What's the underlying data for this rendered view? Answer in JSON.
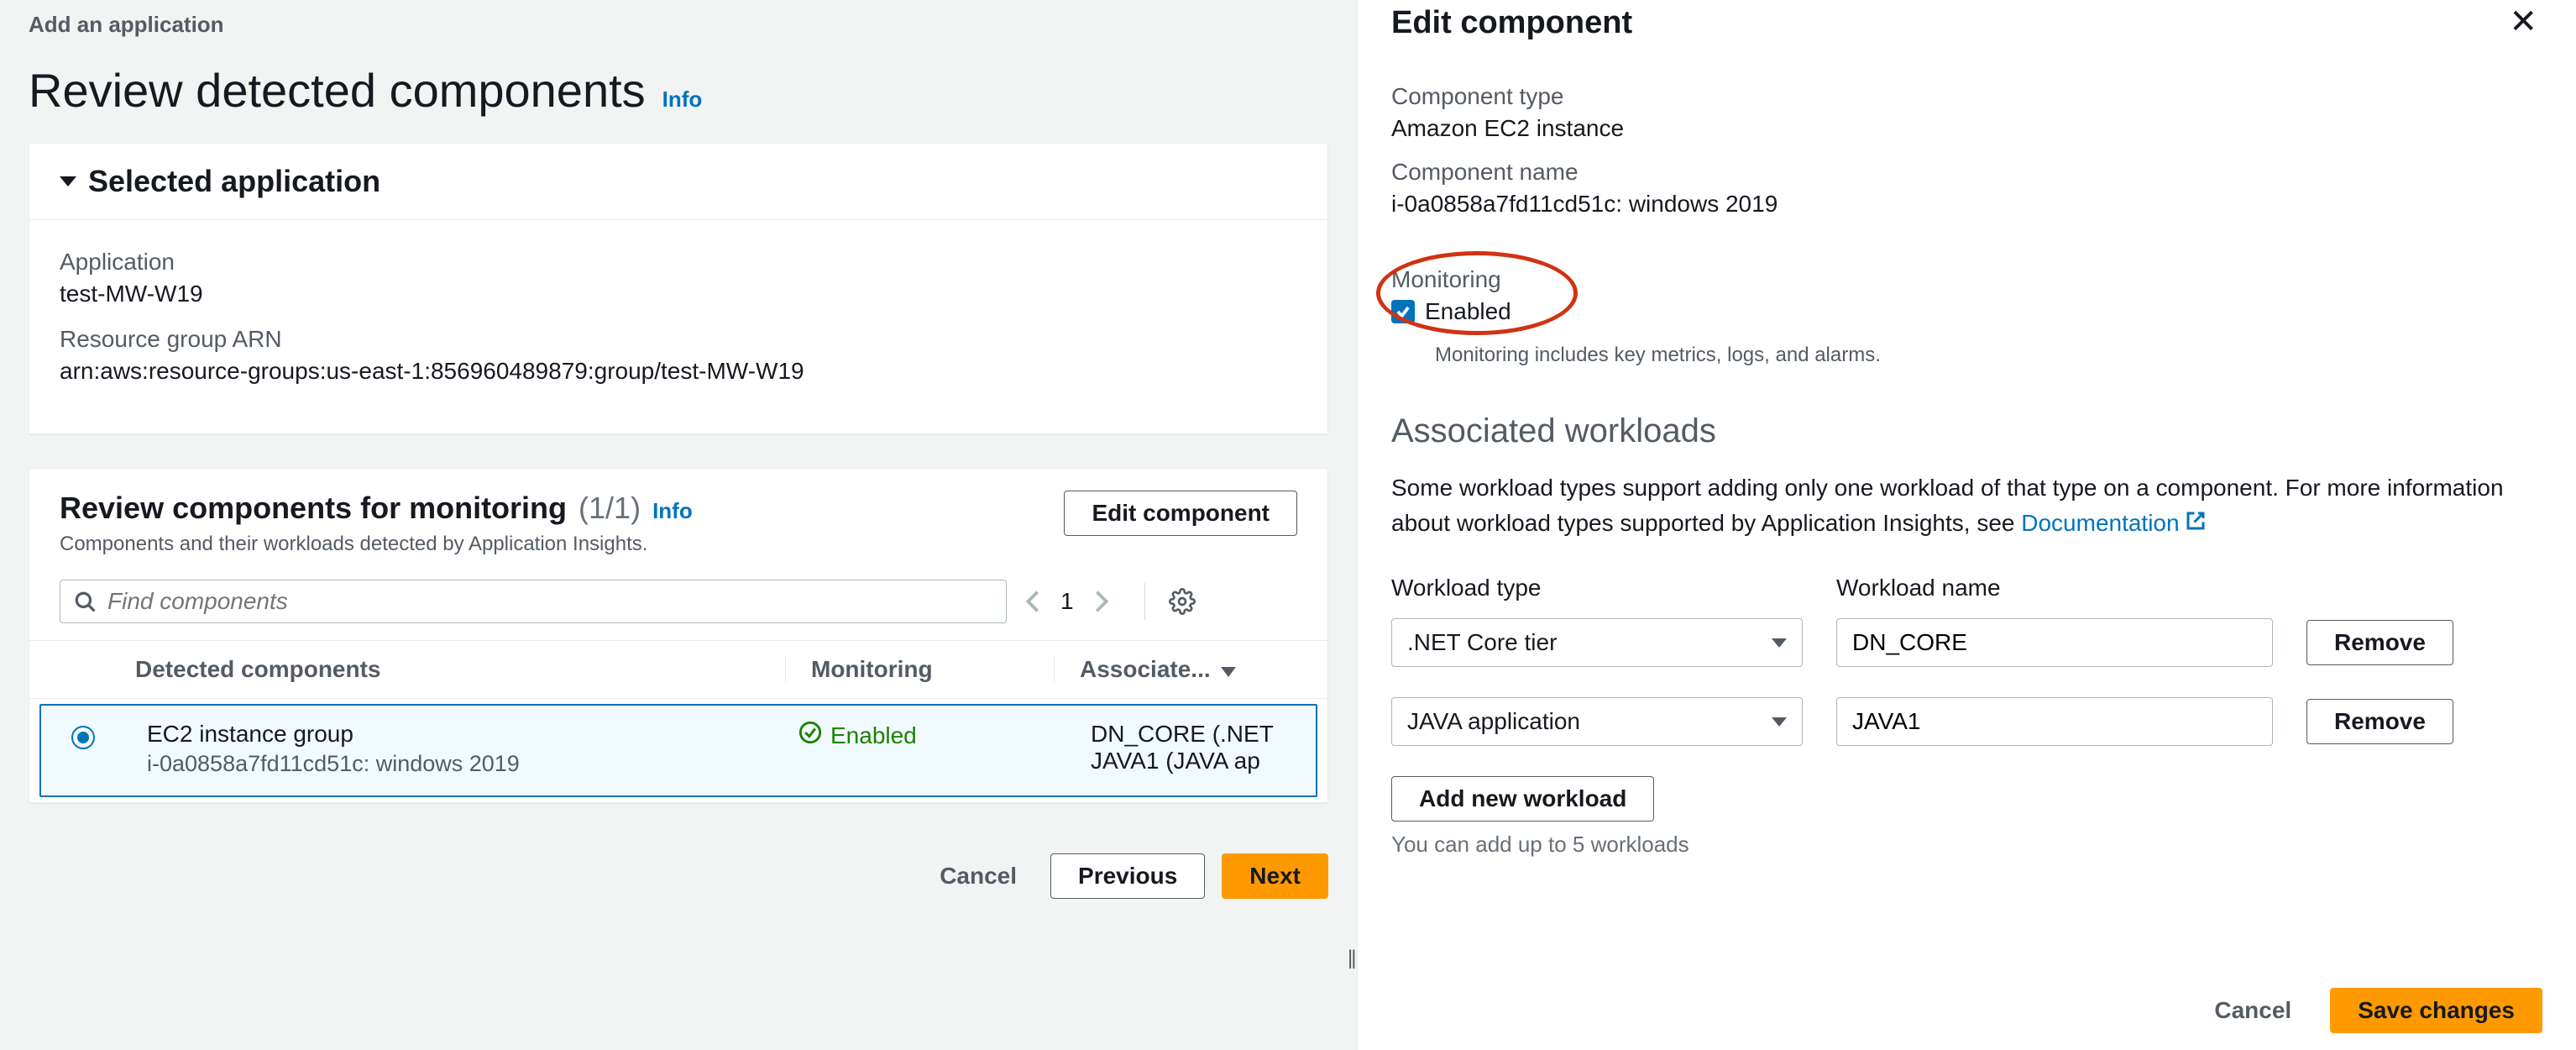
{
  "breadcrumb": "Add an application",
  "title": "Review detected components",
  "info_label": "Info",
  "selected_app": {
    "header": "Selected application",
    "application_label": "Application",
    "application_value": "test-MW-W19",
    "arn_label": "Resource group ARN",
    "arn_value": "arn:aws:resource-groups:us-east-1:856960489879:group/test-MW-W19"
  },
  "review": {
    "title": "Review components for monitoring",
    "count": "(1/1)",
    "desc": "Components and their workloads detected by Application Insights.",
    "edit_btn": "Edit component",
    "search_placeholder": "Find components",
    "page_num": "1",
    "cols": {
      "detected": "Detected components",
      "monitoring": "Monitoring",
      "assoc": "Associate..."
    },
    "row": {
      "name": "EC2 instance group",
      "sub": "i-0a0858a7fd11cd51c: windows 2019",
      "monitoring": "Enabled",
      "workloads": [
        "DN_CORE (.NET",
        "JAVA1 (JAVA ap"
      ]
    }
  },
  "page_actions": {
    "cancel": "Cancel",
    "previous": "Previous",
    "next": "Next"
  },
  "panel": {
    "title": "Edit component",
    "component_type_label": "Component type",
    "component_type_value": "Amazon EC2 instance",
    "component_name_label": "Component name",
    "component_name_value": "i-0a0858a7fd11cd51c: windows 2019",
    "monitoring_label": "Monitoring",
    "monitoring_enabled": "Enabled",
    "monitoring_hint": "Monitoring includes key metrics, logs, and alarms.",
    "assoc_title": "Associated workloads",
    "assoc_desc_1": "Some workload types support adding only one workload of that type on a component. For more information about workload types supported by Application Insights, see ",
    "assoc_doc_link": "Documentation",
    "wl_type_label": "Workload type",
    "wl_name_label": "Workload name",
    "workloads": [
      {
        "type": ".NET Core tier",
        "name": "DN_CORE"
      },
      {
        "type": "JAVA application",
        "name": "JAVA1"
      }
    ],
    "remove_btn": "Remove",
    "add_btn": "Add new workload",
    "add_hint": "You can add up to 5 workloads",
    "cancel": "Cancel",
    "save": "Save changes"
  }
}
